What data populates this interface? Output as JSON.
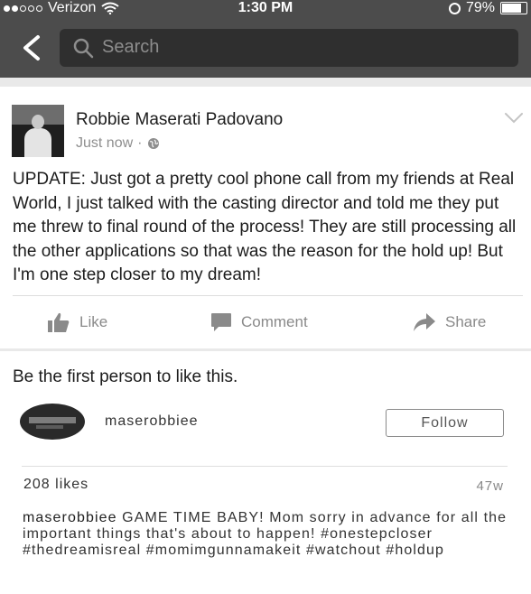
{
  "status_bar": {
    "carrier": "Verizon",
    "time": "1:30 PM",
    "battery": "79%",
    "battery_level": 0.79,
    "signal_bars": 2
  },
  "nav": {
    "search_placeholder": "Search"
  },
  "post": {
    "author": "Robbie Maserati Padovano",
    "timestamp": "Just now",
    "separator": "·",
    "text": "UPDATE: Just got a pretty cool phone call from my friends at Real World, I just talked with the casting director and told me they put me threw to final round of the process! They are still processing all the other applications so that was the reason for the hold up! But I'm one step closer to my dream!",
    "actions": {
      "like": "Like",
      "comment": "Comment",
      "share": "Share"
    },
    "likes_text": "Be the first person to like this."
  },
  "embed": {
    "username": "maserobbiee",
    "follow_label": "Follow",
    "likes": "208 likes",
    "age": "47w",
    "caption_user": "maserobbiee",
    "caption_text": "GAME TIME BABY! Mom sorry in advance for all the important things that's about to happen! #onestepcloser #thedreamisreal #momimgunnamakeit #watchout #holdup"
  },
  "colors": {
    "bar": "#4c4c4c",
    "search_field": "#2f2f2f",
    "muted": "#8a8a8a"
  },
  "icons": [
    "back-arrow-icon",
    "search-icon",
    "globe-icon",
    "chevron-down-icon",
    "like-icon",
    "comment-icon",
    "share-icon",
    "wifi-icon",
    "alarm-icon",
    "battery-icon"
  ]
}
